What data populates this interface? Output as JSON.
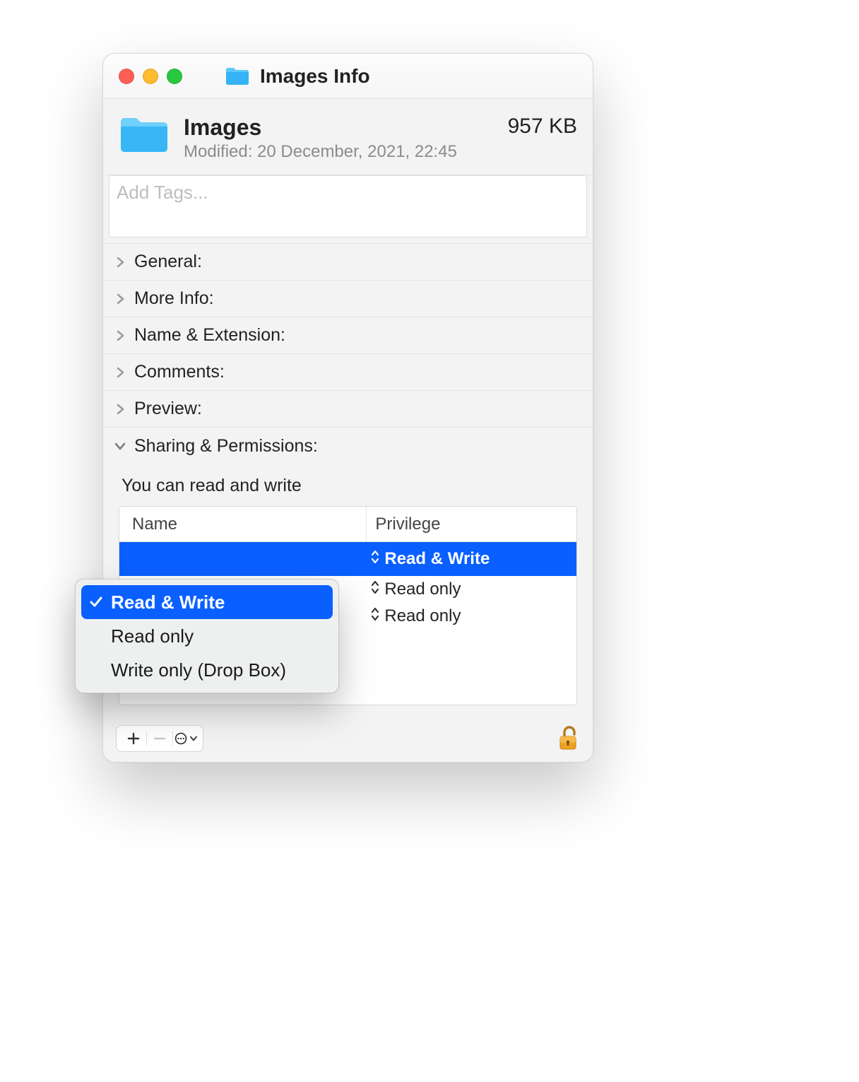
{
  "titlebar": {
    "title": "Images Info"
  },
  "header": {
    "name": "Images",
    "modified": "Modified: 20 December, 2021, 22:45",
    "size": "957 KB"
  },
  "tags": {
    "placeholder": "Add Tags..."
  },
  "sections": {
    "general": "General:",
    "more_info": "More Info:",
    "name_ext": "Name & Extension:",
    "comments": "Comments:",
    "preview": "Preview:",
    "sharing": "Sharing & Permissions:"
  },
  "permissions": {
    "note": "You can read and write",
    "col_name": "Name",
    "col_privilege": "Privilege",
    "rows": [
      {
        "privilege": "Read & Write",
        "selected": true
      },
      {
        "privilege": "Read only",
        "selected": false
      },
      {
        "privilege": "Read only",
        "selected": false
      }
    ]
  },
  "popup": {
    "items": [
      {
        "label": "Read & Write",
        "checked": true,
        "selected": true
      },
      {
        "label": "Read only",
        "checked": false,
        "selected": false
      },
      {
        "label": "Write only (Drop Box)",
        "checked": false,
        "selected": false
      }
    ]
  }
}
